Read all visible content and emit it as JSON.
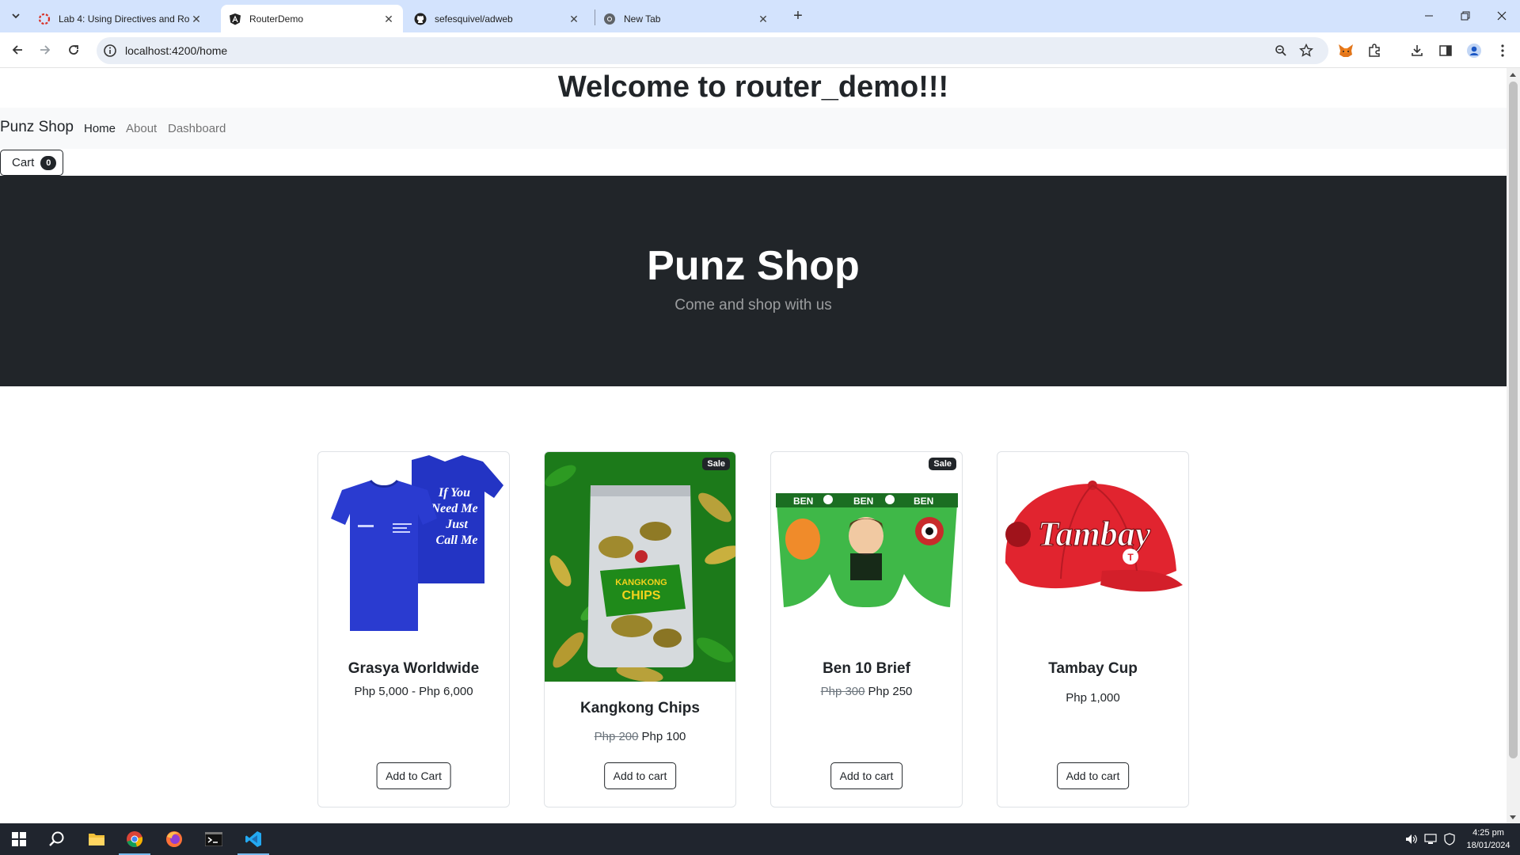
{
  "browser": {
    "tabs": [
      {
        "title": "Lab 4: Using Directives and Rou",
        "icon": "lab-favicon"
      },
      {
        "title": "RouterDemo",
        "icon": "angular-favicon"
      },
      {
        "title": "sefesquivel/adweb",
        "icon": "github-favicon"
      },
      {
        "title": "New Tab",
        "icon": "chrome-favicon"
      }
    ],
    "url": "localhost:4200/home"
  },
  "page": {
    "welcome": "Welcome to router_demo!!!",
    "navbar": {
      "brand": "Punz Shop",
      "links": [
        "Home",
        "About",
        "Dashboard"
      ],
      "active_link": "Home"
    },
    "cart": {
      "label": "Cart",
      "count": "0"
    },
    "hero": {
      "title": "Punz Shop",
      "subtitle": "Come and shop with us"
    },
    "products": [
      {
        "name": "Grasya Worldwide",
        "price": "Php 5,000 - Php 6,000",
        "old_price": "",
        "sale": "",
        "button": "Add to Cart",
        "image": "blue-tshirts"
      },
      {
        "name": "Kangkong Chips",
        "price": "Php 100",
        "old_price": "Php 200",
        "sale": "Sale",
        "button": "Add to cart",
        "image": "chips-pouch-on-leaves"
      },
      {
        "name": "Ben 10 Brief",
        "price": "Php 250",
        "old_price": "Php 300",
        "sale": "Sale",
        "button": "Add to cart",
        "image": "ben10-brief"
      },
      {
        "name": "Tambay Cup",
        "price": "Php 1,000",
        "old_price": "",
        "sale": "",
        "button": "Add to cart",
        "image": "red-cap"
      }
    ]
  },
  "taskbar": {
    "time": "4:25 pm",
    "date": "18/01/2024"
  },
  "colors": {
    "accent": "#212529",
    "tabstrip": "#d3e3fd",
    "taskbar": "#20252e"
  }
}
